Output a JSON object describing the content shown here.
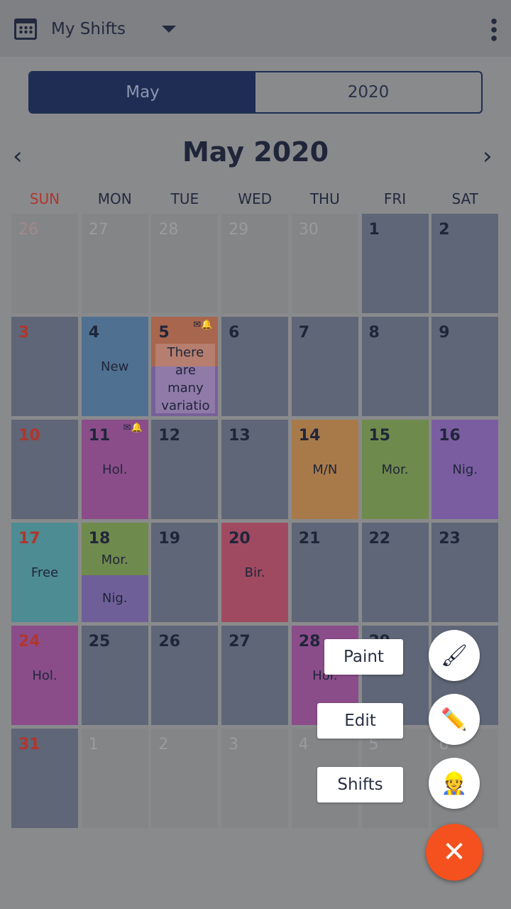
{
  "header": {
    "title": "My Shifts",
    "calendar_icon": "calendar-icon",
    "menu_icon": "more-vert-icon"
  },
  "segment": {
    "month": "May",
    "year": "2020"
  },
  "calendar": {
    "title": "May 2020",
    "prev": "‹",
    "next": "›",
    "weekdays": [
      "SUN",
      "MON",
      "TUE",
      "WED",
      "THU",
      "FRI",
      "SAT"
    ],
    "days": [
      {
        "n": "26",
        "other": true
      },
      {
        "n": "27",
        "other": true
      },
      {
        "n": "28",
        "other": true
      },
      {
        "n": "29",
        "other": true
      },
      {
        "n": "30",
        "other": true
      },
      {
        "n": "1"
      },
      {
        "n": "2"
      },
      {
        "n": "3"
      },
      {
        "n": "4",
        "color": "#4f7090",
        "label": "New"
      },
      {
        "n": "5",
        "top": "#a8664e",
        "bottom": "#77609a",
        "note": "There are many variatio",
        "icons": true
      },
      {
        "n": "6"
      },
      {
        "n": "7"
      },
      {
        "n": "8"
      },
      {
        "n": "9"
      },
      {
        "n": "10"
      },
      {
        "n": "11",
        "color": "#8a4d8a",
        "label": "Hol.",
        "icons": true
      },
      {
        "n": "12"
      },
      {
        "n": "13"
      },
      {
        "n": "14",
        "color": "#a87a4a",
        "label": "M/N"
      },
      {
        "n": "15",
        "color": "#6f8a4d",
        "label": "Mor."
      },
      {
        "n": "16",
        "color": "#7a5da0",
        "label": "Nig."
      },
      {
        "n": "17",
        "color": "#4d8c92",
        "label": "Free"
      },
      {
        "n": "18",
        "top": "#6f8a4d",
        "bottom": "#6e5f98",
        "label": "Mor.",
        "label2": "Nig."
      },
      {
        "n": "19"
      },
      {
        "n": "20",
        "color": "#a04a62",
        "label": "Bir."
      },
      {
        "n": "21"
      },
      {
        "n": "22"
      },
      {
        "n": "23"
      },
      {
        "n": "24",
        "color": "#8a4d8a",
        "label": "Hol."
      },
      {
        "n": "25"
      },
      {
        "n": "26"
      },
      {
        "n": "27"
      },
      {
        "n": "28",
        "color": "#8a4d8a",
        "label": "Hol."
      },
      {
        "n": "29"
      },
      {
        "n": "30"
      },
      {
        "n": "31"
      },
      {
        "n": "1",
        "other": true
      },
      {
        "n": "2",
        "other": true
      },
      {
        "n": "3",
        "other": true
      },
      {
        "n": "4",
        "other": true
      },
      {
        "n": "5",
        "other": true
      },
      {
        "n": "6",
        "other": true
      }
    ]
  },
  "fab_menu": [
    {
      "label": "Paint",
      "icon": "paintbrush-icon",
      "glyph": "🖌"
    },
    {
      "label": "Edit",
      "icon": "pencil-icon",
      "glyph": "✏️"
    },
    {
      "label": "Shifts",
      "icon": "worker-clock-icon",
      "glyph": "👷"
    }
  ],
  "close_glyph": "✕",
  "colors": {
    "accent": "#f4511e",
    "primary": "#1f2d55",
    "sunday": "#b0362e"
  }
}
